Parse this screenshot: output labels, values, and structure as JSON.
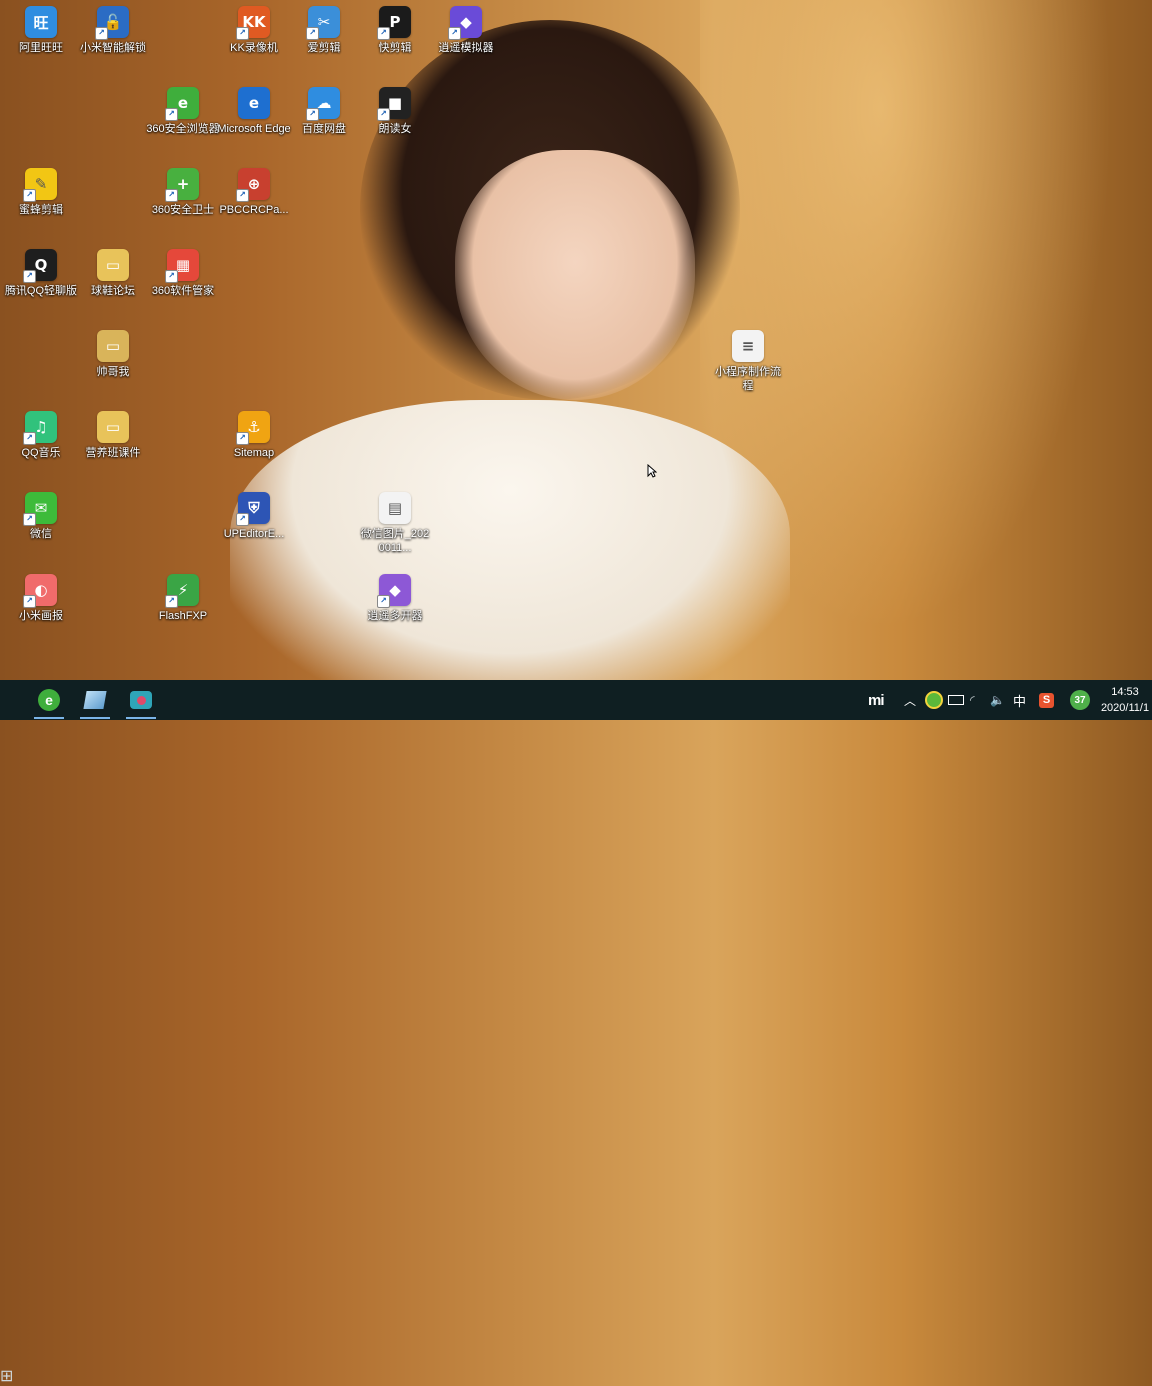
{
  "desktop": {
    "icons": [
      {
        "label": "阿里旺旺",
        "icon": "aliwangwang-icon",
        "color": "#2f8de0",
        "glyph": "旺",
        "shortcut": false
      },
      {
        "label": "小米智能解锁",
        "icon": "unlock-icon",
        "color": "#2b6cc4",
        "glyph": "🔓",
        "shortcut": true
      },
      {
        "label": "KK录像机",
        "icon": "kk-recorder-icon",
        "color": "#e05a22",
        "glyph": "KK",
        "shortcut": true
      },
      {
        "label": "爱剪辑",
        "icon": "aijianji-icon",
        "color": "#3b8fd9",
        "glyph": "✂",
        "shortcut": true
      },
      {
        "label": "快剪辑",
        "icon": "kuaijianji-icon",
        "color": "#1b1b1b",
        "glyph": "P",
        "shortcut": true
      },
      {
        "label": "逍遥模拟器",
        "icon": "xiaoyao-emulator-icon",
        "color": "#6a4bd8",
        "glyph": "◆",
        "shortcut": true
      },
      {
        "label": "360安全浏览器",
        "icon": "360-browser-icon",
        "color": "#3fae3c",
        "glyph": "e",
        "shortcut": true
      },
      {
        "label": "Microsoft Edge",
        "icon": "edge-icon",
        "color": "#1e6fd0",
        "glyph": "e",
        "shortcut": false
      },
      {
        "label": "百度网盘",
        "icon": "baidu-netdisk-icon",
        "color": "#2f8de0",
        "glyph": "☁",
        "shortcut": true
      },
      {
        "label": "朗读女",
        "icon": "langdunv-icon",
        "color": "#222222",
        "glyph": "■",
        "shortcut": true
      },
      {
        "label": "蜜蜂剪辑",
        "icon": "bee-editor-icon",
        "color": "#f2c614",
        "glyph": "✎",
        "shortcut": true
      },
      {
        "label": "360安全卫士",
        "icon": "360-security-icon",
        "color": "#48b03f",
        "glyph": "+",
        "shortcut": true
      },
      {
        "label": "PBCCRCPa...",
        "icon": "pbccrc-icon",
        "color": "#c8402f",
        "glyph": "⊕",
        "shortcut": true
      },
      {
        "label": "腾讯QQ轻聊版",
        "icon": "qq-icon",
        "color": "#1e1e1e",
        "glyph": "Q",
        "shortcut": true
      },
      {
        "label": "球鞋论坛",
        "icon": "folder-icon",
        "color": "#e8c35a",
        "glyph": "▭",
        "shortcut": false
      },
      {
        "label": "360软件管家",
        "icon": "360-software-icon",
        "color": "#e5483a",
        "glyph": "▦",
        "shortcut": true
      },
      {
        "label": "帅哥我",
        "icon": "folder-icon",
        "color": "#d9b45a",
        "glyph": "▭",
        "shortcut": false
      },
      {
        "label": "小程序制作流程",
        "icon": "document-icon",
        "color": "#f3f3f3",
        "glyph": "≡",
        "shortcut": false
      },
      {
        "label": "QQ音乐",
        "icon": "qq-music-icon",
        "color": "#31c27c",
        "glyph": "♫",
        "shortcut": true
      },
      {
        "label": "营养班课件",
        "icon": "folder-icon",
        "color": "#e8c35a",
        "glyph": "▭",
        "shortcut": false
      },
      {
        "label": "Sitemap",
        "icon": "sitemap-icon",
        "color": "#f0a412",
        "glyph": "⚓",
        "shortcut": true
      },
      {
        "label": "微信",
        "icon": "wechat-icon",
        "color": "#3dbb3a",
        "glyph": "✉",
        "shortcut": true
      },
      {
        "label": "UPEditorE...",
        "icon": "upeditor-icon",
        "color": "#2d55b5",
        "glyph": "⛨",
        "shortcut": true
      },
      {
        "label": "微信图片_2020011...",
        "icon": "image-file-icon",
        "color": "#f3f3f3",
        "glyph": "▤",
        "shortcut": false
      },
      {
        "label": "小米画报",
        "icon": "mi-gallery-icon",
        "color": "#f06b6b",
        "glyph": "◐",
        "shortcut": true
      },
      {
        "label": "FlashFXP",
        "icon": "flashfxp-icon",
        "color": "#3aa545",
        "glyph": "⚡",
        "shortcut": true
      },
      {
        "label": "逍遥多开器",
        "icon": "xiaoyao-multi-icon",
        "color": "#8d58d6",
        "glyph": "◆",
        "shortcut": true
      }
    ]
  },
  "taskbar": {
    "apps": [
      {
        "icon": "360-browser-icon",
        "color": "#3fae3c",
        "glyph": "e"
      },
      {
        "icon": "notepad-icon",
        "color": "#6aa9d6",
        "glyph": "▰"
      },
      {
        "icon": "screen-recorder-icon",
        "color": "#e04a6a",
        "glyph": "●"
      }
    ],
    "tray": {
      "mi_logo": "mi",
      "ime": "中",
      "badge_count": "37",
      "time": "14:53",
      "date": "2020/11/1"
    }
  }
}
